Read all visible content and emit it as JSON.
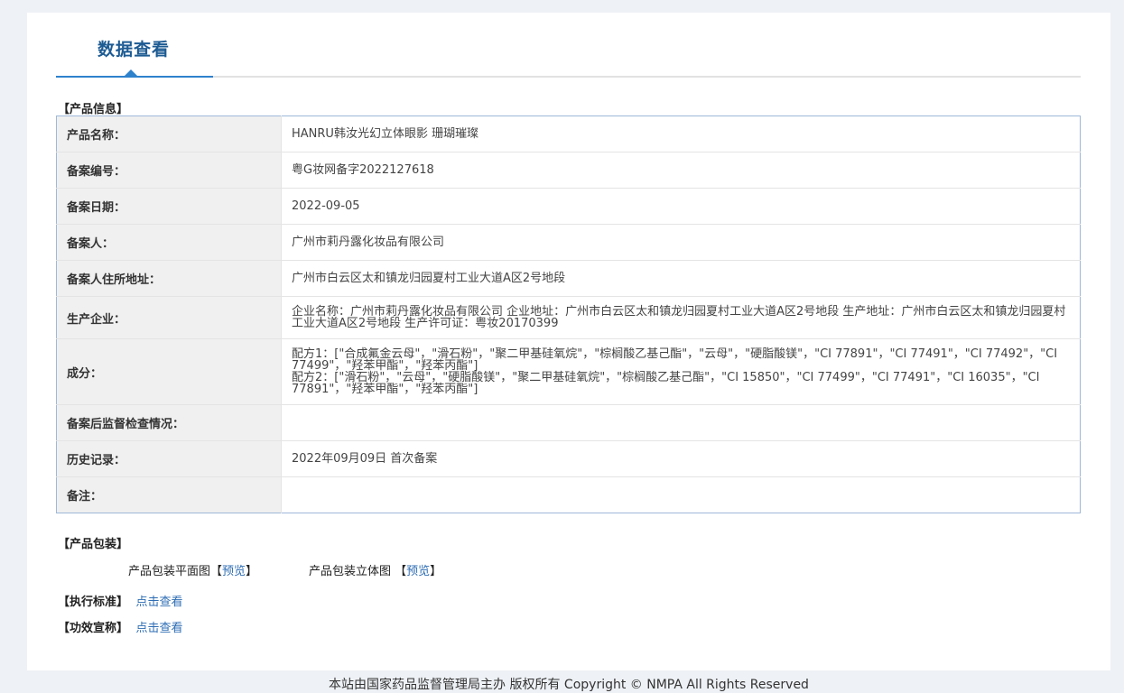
{
  "tab": {
    "title": "数据查看"
  },
  "product_info": {
    "section_title": "【产品信息】",
    "rows": [
      {
        "label": "产品名称：",
        "value": "HANRU韩汝光幻立体眼影 珊瑚璀璨"
      },
      {
        "label": "备案编号：",
        "value": "粤G妆网备字2022127618"
      },
      {
        "label": "备案日期：",
        "value": "2022-09-05"
      },
      {
        "label": "备案人：",
        "value": "广州市莉丹露化妆品有限公司"
      },
      {
        "label": "备案人住所地址：",
        "value": "广州市白云区太和镇龙归园夏村工业大道A区2号地段"
      },
      {
        "label": "生产企业：",
        "value": "企业名称：广州市莉丹露化妆品有限公司 企业地址：广州市白云区太和镇龙归园夏村工业大道A区2号地段 生产地址：广州市白云区太和镇龙归园夏村工业大道A区2号地段 生产许可证：粤妆20170399"
      },
      {
        "label": "成分：",
        "value": "",
        "line1": "配方1：[\"合成氟金云母\"，\"滑石粉\"，\"聚二甲基硅氧烷\"，\"棕榈酸乙基己酯\"，\"云母\"，\"硬脂酸镁\"，\"CI 77891\"，\"CI 77491\"，\"CI 77492\"，\"CI 77499\"，\"羟苯甲酯\"，\"羟苯丙酯\"]",
        "line2": "配方2：[\"滑石粉\"，\"云母\"，\"硬脂酸镁\"，\"聚二甲基硅氧烷\"，\"棕榈酸乙基己酯\"，\"CI 15850\"，\"CI 77499\"，\"CI 77491\"，\"CI 16035\"，\"CI 77891\"，\"羟苯甲酯\"，\"羟苯丙酯\"]"
      },
      {
        "label": "备案后监督检查情况：",
        "value": ""
      },
      {
        "label": "历史记录：",
        "value": "2022年09月09日 首次备案"
      },
      {
        "label": "备注：",
        "value": ""
      }
    ]
  },
  "packaging": {
    "section_title": "【产品包装】",
    "flat_label": "产品包装平面图",
    "flat_link": "预览",
    "solid_label": "产品包装立体图",
    "solid_link": "预览"
  },
  "standard": {
    "section_title": "【执行标准】",
    "link": "点击查看"
  },
  "efficacy": {
    "section_title": "【功效宣称】",
    "link": "点击查看"
  },
  "footer": {
    "text": "本站由国家药品监督管理局主办 版权所有 Copyright © NMPA All Rights Reserved"
  }
}
